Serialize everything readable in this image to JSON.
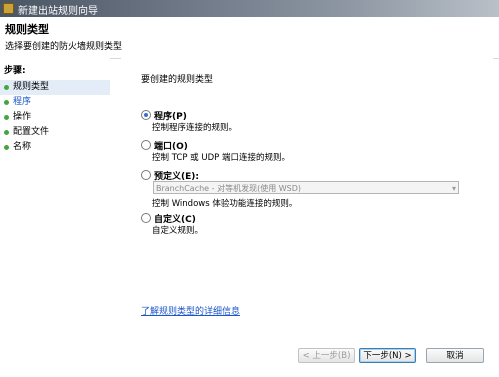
{
  "window": {
    "title": "新建出站规则向导",
    "header_title": "规则类型",
    "header_subtitle": "选择要创建的防火墙规则类型"
  },
  "sidebar": {
    "title": "步骤:",
    "items": [
      {
        "label": "规则类型"
      },
      {
        "label": "程序"
      },
      {
        "label": "操作"
      },
      {
        "label": "配置文件"
      },
      {
        "label": "名称"
      }
    ]
  },
  "main": {
    "prompt": "要创建的规则类型",
    "options": [
      {
        "label": "程序(P)",
        "description": "控制程序连接的规则。",
        "selected": true
      },
      {
        "label": "端口(O)",
        "description": "控制 TCP 或 UDP 端口连接的规则。",
        "selected": false
      },
      {
        "label": "预定义(E):",
        "description": "控制 Windows 体验功能连接的规则。",
        "selected": false
      },
      {
        "label": "自定义(C)",
        "description": "自定义规则。",
        "selected": false
      }
    ],
    "predefined_select": "BranchCache - 对等机发现(使用 WSD)",
    "help_link": "了解规则类型的详细信息"
  },
  "footer": {
    "back": "< 上一步(B)",
    "next": "下一步(N) >",
    "cancel": "取消"
  }
}
